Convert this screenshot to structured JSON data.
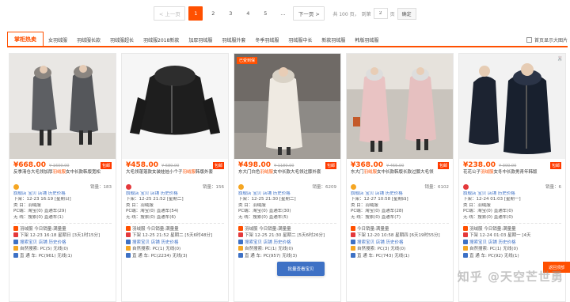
{
  "pager": {
    "prev": "< 上一页",
    "pages": [
      "1",
      "2",
      "3",
      "4",
      "5"
    ],
    "active": "1",
    "ellipsis": "...",
    "next": "下一页 >",
    "total": "共 100 页，",
    "goto": "到第",
    "page_value": "2",
    "page_unit": "页",
    "confirm": "确定"
  },
  "tabs": {
    "items": [
      "掌柜热卖",
      "女羽绒服",
      "羽绒服长款",
      "羽绒服超长",
      "羽绒服2018新款",
      "加厚羽绒服",
      "羽绒服外套",
      "冬季羽绒服",
      "羽绒服中长",
      "新款羽绒服",
      "韩版羽绒服"
    ],
    "right_label": "首页显示大图片"
  },
  "cards": [
    {
      "tag": "",
      "price": "¥668.00",
      "orig": "¥ 1600.00",
      "badge": "包邮",
      "title_pre": "反季清仓大毛领加厚",
      "title_hl": "羽绒服",
      "title_post": "女中长款韩版宽松",
      "sales": "销量：183",
      "shop": "旗舰店 宝贝 店铺 历史价格",
      "l1": "下架：12-23 16:19 [星期日]",
      "l2": "类 目：羽绒服",
      "l3": "PC端：淘宝(0) 直通车(29)",
      "l4": "无 线：搜索(0) 直通车(1)",
      "l5": "羽绒服 今日销量:满量量",
      "l6": "下架 12-23 16:18 星期日 [3天1时15分]",
      "l7": "搜索宝贝 店铺 历史价格",
      "l8": "自然搜索: PC(5) 无线(0)",
      "l9": "直 通 车: PC(961) 无线(1)"
    },
    {
      "tag": "",
      "price": "¥458.00",
      "orig": "¥ 680.00",
      "badge": "包邮",
      "title_pre": "大毛领蓬蓬款女装娃娃小个子",
      "title_hl": "羽绒服",
      "title_post": "韩版外套",
      "sales": "销量：156",
      "shop": "旗舰店 宝贝 店铺 历史价格",
      "l1": "下架：12-25 21:52 [星期二]",
      "l2": "类 目：羽绒服",
      "l3": "PC端：淘宝(0) 直通车(54)",
      "l4": "无 线：搜索(0) 直通车(6)",
      "l5": "羽绒服 今日销量:满量量",
      "l6": "下架 12-25 21:52 星期二 [5天6时48分]",
      "l7": "搜索宝贝 店铺 历史价格",
      "l8": "自然搜索: PC(1) 无线(0)",
      "l9": "直 通 车: PC(2234) 无线(3)"
    },
    {
      "tag": "已受到保",
      "price": "¥498.00",
      "orig": "¥ 1180.00",
      "badge": "包邮",
      "title_pre": "东大门白色",
      "title_hl": "羽绒服",
      "title_post": "女中长款大毛领过膝外套",
      "sales": "销量：6209",
      "shop": "旗舰店 宝贝 店铺 历史价格",
      "l1": "下架：12-25 21:30 [星期二]",
      "l2": "类 目：羽绒服",
      "l3": "PC端：淘宝(0) 直通车(30)",
      "l4": "无 线：搜索(0) 直通车(5)",
      "l5": "羽绒服 今日销量:满量量",
      "l6": "下架 12-25 21:30 星期二 [5天6时26分]",
      "l7": "搜索宝贝 店铺 历史价格",
      "l8": "自然搜索: PC(1) 无线(0)",
      "l9": "直 通 车: PC(957) 无线(3)"
    },
    {
      "tag": "",
      "price": "¥368.00",
      "orig": "¥ 455.00",
      "badge": "包邮",
      "title_pre": "东大门",
      "title_hl": "羽绒服",
      "title_post": "女中长款韩版长款过膝大毛领",
      "sales": "销量：6102",
      "shop": "旗舰店 宝贝 店铺 历史价格",
      "l1": "下架：12-27 10:58 [星期四]",
      "l2": "类 目：羽绒服",
      "l3": "PC端：淘宝(0) 直通车(28)",
      "l4": "无 线：搜索(0) 直通车(7)",
      "l5": "今日销量:满量量",
      "l6": "下架 12-20 10:58 星期四 [6天19时55分]",
      "l7": "搜索宝贝 店铺 历史价格",
      "l8": "自然搜索: PC(3) 无线(0)",
      "l9": "直 通 车: PC(743) 无线(1)"
    },
    {
      "tag": "",
      "price": "¥238.00",
      "orig": "¥ 300.00",
      "badge": "包邮",
      "title_pre": "花花公子",
      "title_hl": "羽绒服",
      "title_post": "女冬中长款男青年韩版",
      "sales": "销量：6",
      "shop": "旗舰店 宝贝 店铺 历史价格",
      "l1": "下架：12-24 01:03 [星期一]",
      "l2": "类 目：羽绒服",
      "l3": "PC端：淘宝(0) 直通车(0)",
      "l4": "无 线：搜索(0) 直通车(0)",
      "l5": "羽绒服 今日销量:满量量",
      "l6": "下架 12-24 01:03 星期一 [4天",
      "l7": "搜索宝贝 店铺 历史价格",
      "l8": "自然搜索: PC(1) 无线(0)",
      "l9": "直 通 车: PC(92) 无线(1)"
    }
  ],
  "floating_button": "批量查看宝贝",
  "side_tab": "返回顶部",
  "watermark": "知乎 @天空芒世勇",
  "colors": {
    "accent": "#ff5000",
    "blue": "#3e71c5"
  }
}
